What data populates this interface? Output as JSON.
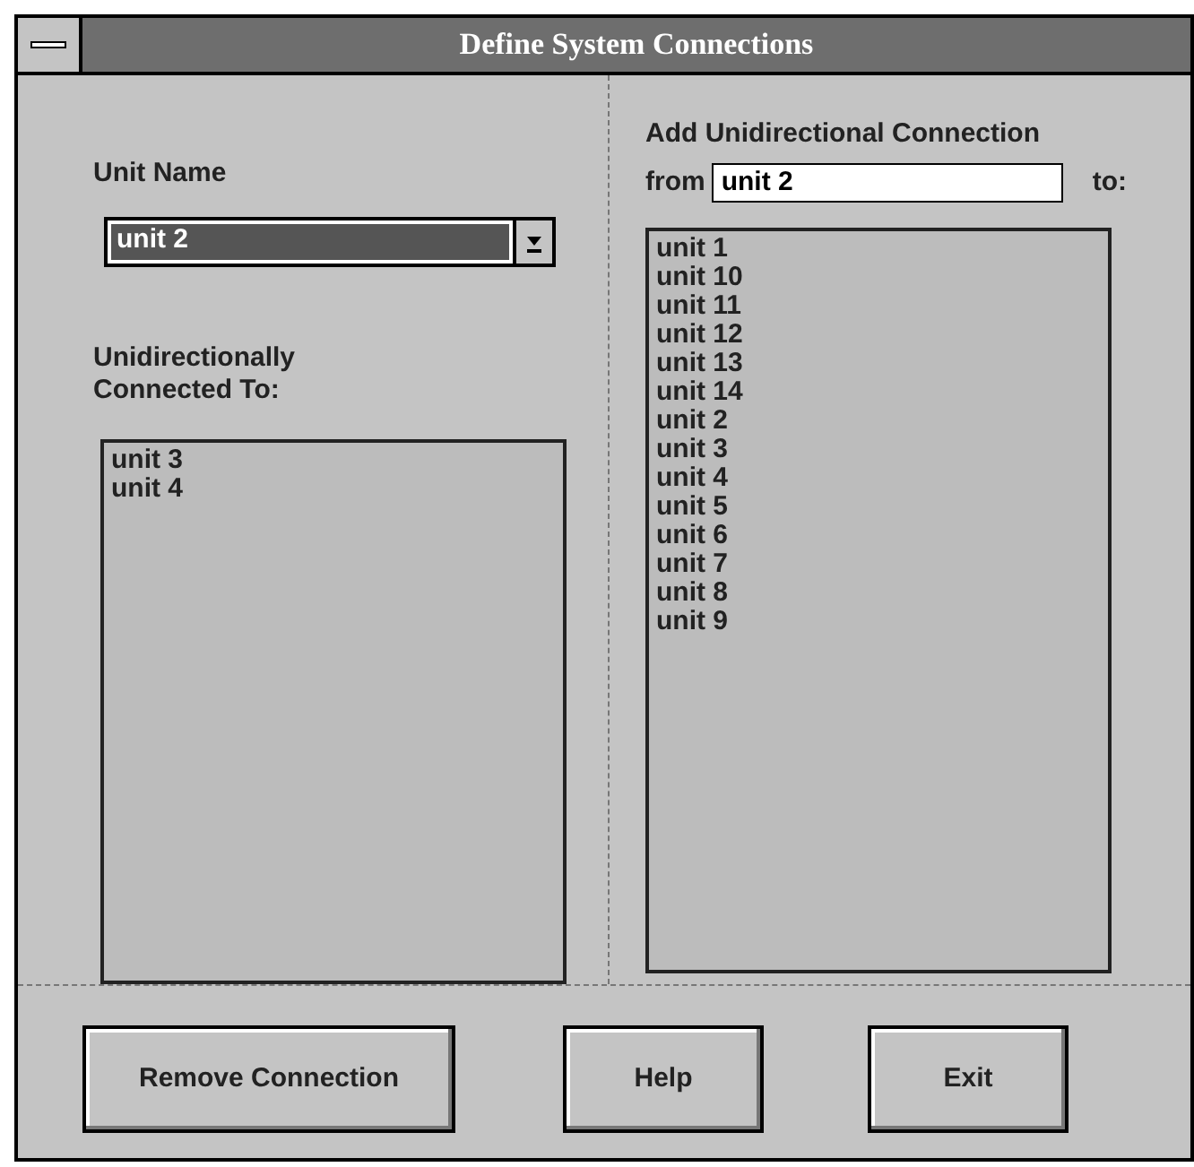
{
  "window": {
    "title": "Define System Connections"
  },
  "unit_name": {
    "label": "Unit Name",
    "value": "unit 2"
  },
  "connected": {
    "label": "Unidirectionally Connected To:",
    "items": [
      "unit 3",
      "unit 4"
    ]
  },
  "add_connection": {
    "label": "Add Unidirectional Connection",
    "from_label": "from",
    "from_value": "unit 2",
    "to_label": "to:",
    "items": [
      "unit 1",
      "unit 10",
      "unit 11",
      "unit 12",
      "unit 13",
      "unit 14",
      "unit 2",
      "unit 3",
      "unit 4",
      "unit 5",
      "unit 6",
      "unit 7",
      "unit 8",
      "unit 9"
    ]
  },
  "buttons": [
    "Remove Connection",
    "Help",
    "Exit"
  ]
}
